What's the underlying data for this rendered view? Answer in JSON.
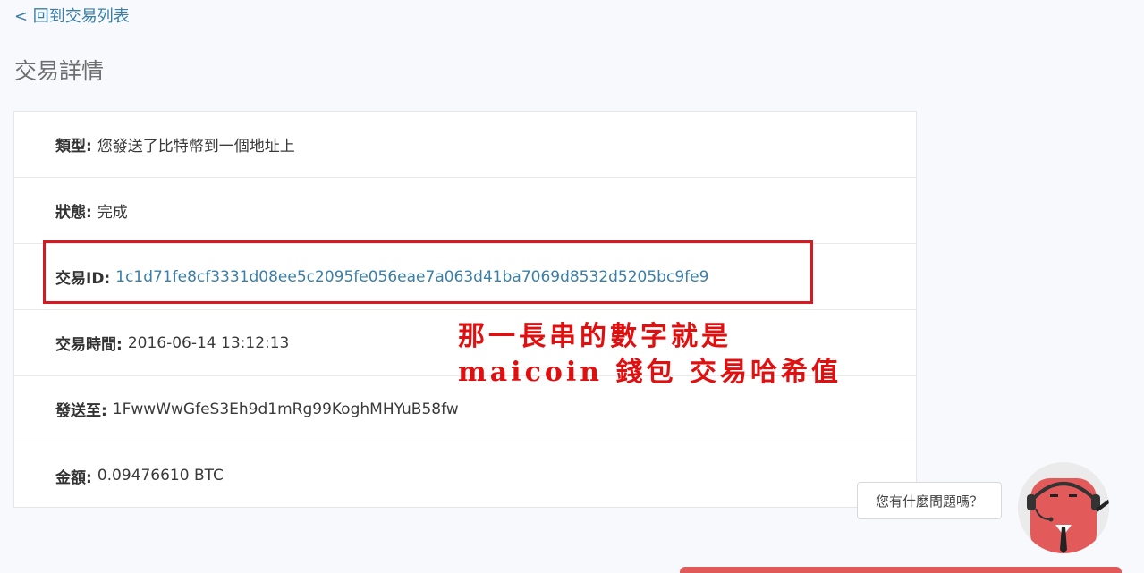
{
  "nav": {
    "back_label": "< 回到交易列表"
  },
  "page": {
    "title": "交易詳情"
  },
  "details": [
    {
      "label": "類型:",
      "value": "您發送了比特幣到一個地址上"
    },
    {
      "label": "狀態:",
      "value": "完成"
    },
    {
      "label": "交易ID:",
      "value": "1c1d71fe8cf3331d08ee5c2095fe056eae7a063d41ba7069d8532d5205bc9fe9"
    },
    {
      "label": "交易時間:",
      "value": "2016-06-14 13:12:13"
    },
    {
      "label": "發送至:",
      "value": "1FwwWwGfeS3Eh9d1mRg99KoghMHYuB58fw"
    },
    {
      "label": "金額:",
      "value": "0.09476610 BTC"
    }
  ],
  "annotation": {
    "line1": "那一長串的數字就是",
    "line2": "maicoin 錢包 交易哈希值"
  },
  "chat": {
    "prompt": "您有什麼問題嗎？",
    "avatar_icon": "support-agent-icon"
  },
  "colors": {
    "link": "#3a7fa8",
    "highlight": "#d71920",
    "annotation": "#e01010",
    "avatar": "#e35a5a"
  }
}
